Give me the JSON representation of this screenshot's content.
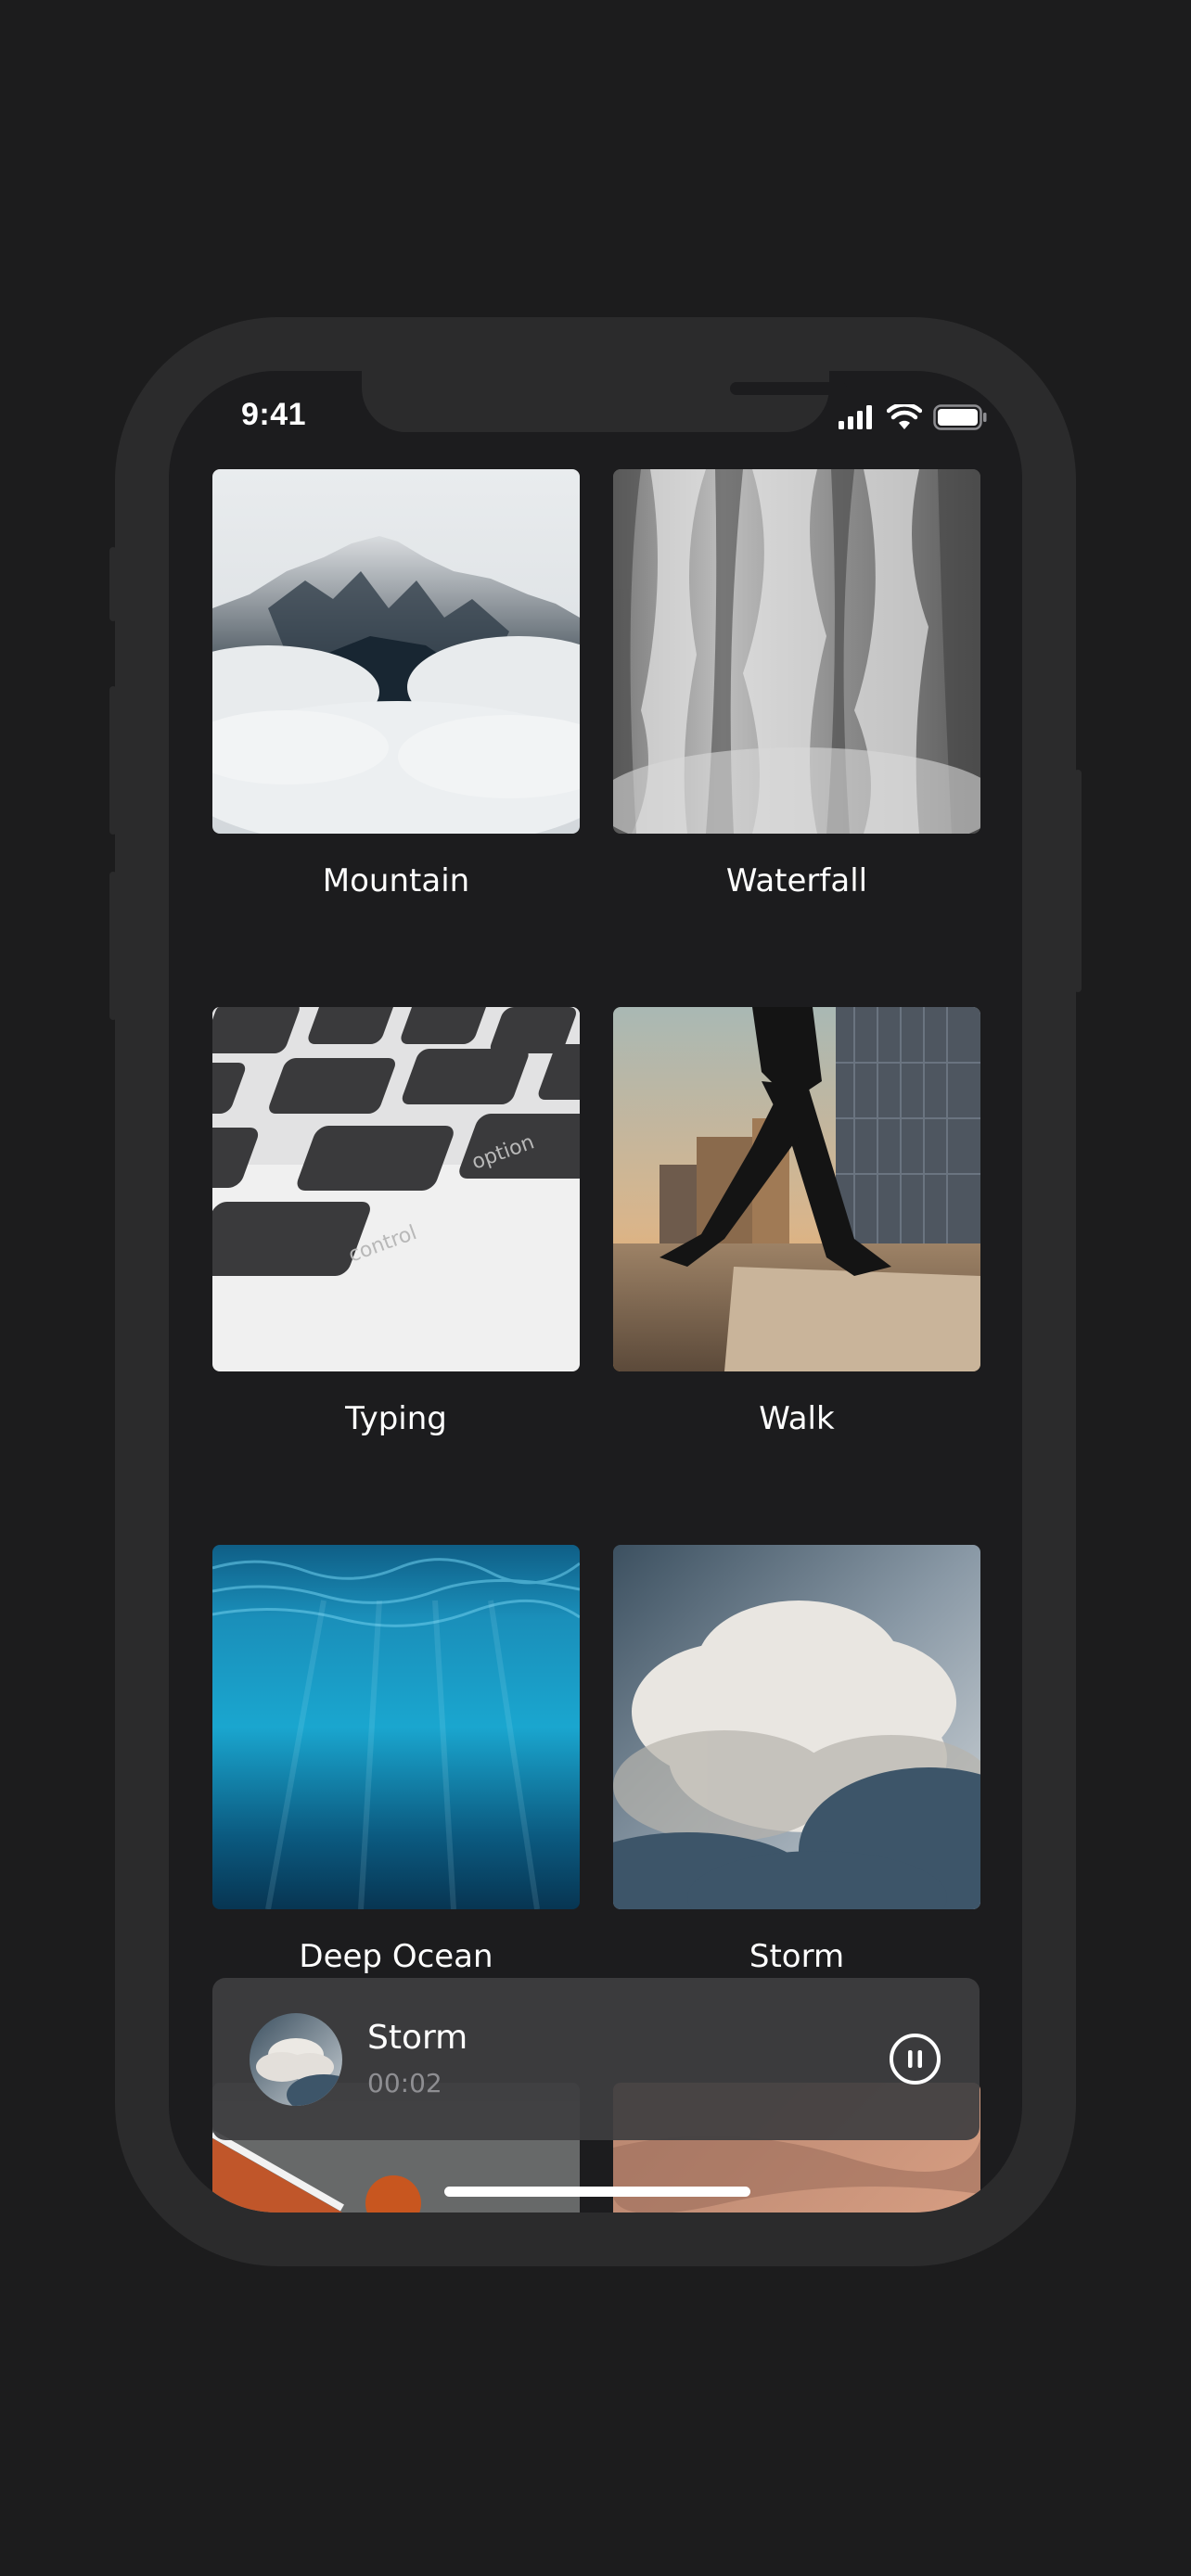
{
  "status_bar": {
    "time": "9:41",
    "icons": [
      "cellular-signal-icon",
      "wifi-icon",
      "battery-icon"
    ]
  },
  "sounds": [
    {
      "label": "Mountain",
      "image": "snowy-mountain-above-clouds"
    },
    {
      "label": "Waterfall",
      "image": "waterfall-mist"
    },
    {
      "label": "Typing",
      "image": "keyboard-keys-option-control"
    },
    {
      "label": "Walk",
      "image": "person-walking-city-street-sunset"
    },
    {
      "label": "Deep Ocean",
      "image": "underwater-blue-ocean"
    },
    {
      "label": "Storm",
      "image": "storm-clouds"
    }
  ],
  "partial_tiles": [
    {
      "image": "basketball-court"
    },
    {
      "image": "desert-dunes"
    }
  ],
  "now_playing": {
    "title": "Storm",
    "elapsed": "00:02",
    "control": "pause-icon"
  },
  "colors": {
    "background": "#1c1c1d",
    "phone_frame": "#2b2b2c",
    "screen": "#1c1c1e",
    "player_bg": "#3e3e40",
    "secondary_text": "#8e8e92"
  }
}
